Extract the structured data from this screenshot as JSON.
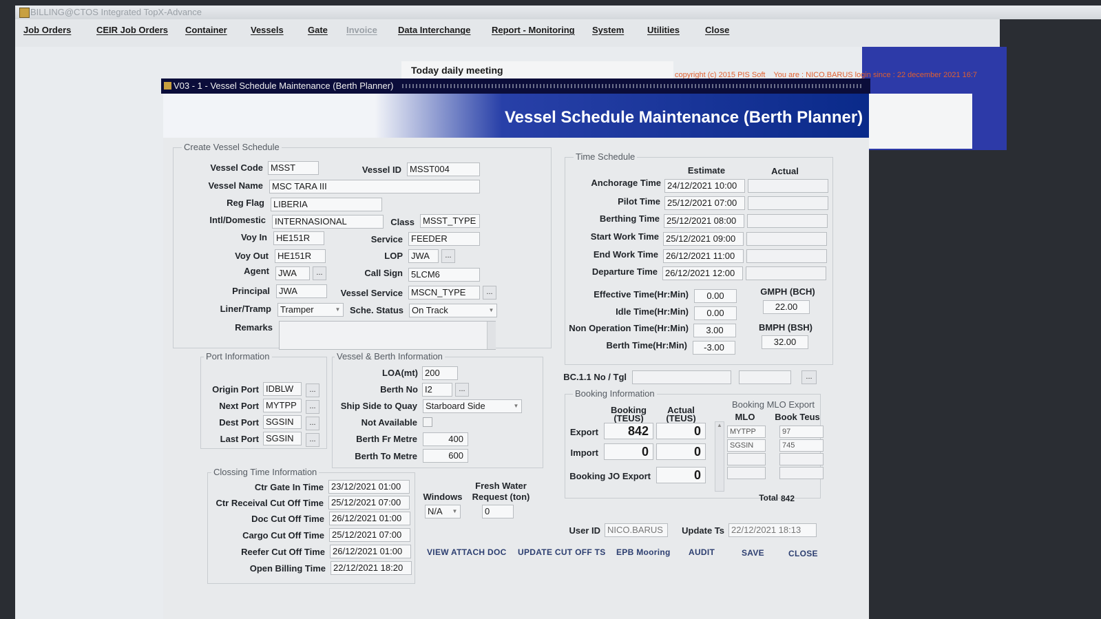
{
  "app": {
    "title": "BILLING@CTOS Integrated TopX-Advance"
  },
  "menu": [
    "Job Orders",
    "CEIR Job Orders",
    "Container",
    "Vessels",
    "Gate",
    "Invoice",
    "Data Interchange",
    "Report - Monitoring",
    "System",
    "Utilities",
    "Close"
  ],
  "banner": {
    "meeting": "Today daily meeting",
    "copyright": "copyright (c) 2015 PIS Soft",
    "user_info": "You are : NICO.BARUS login since : 22 december 2021 16:7"
  },
  "dialog": {
    "window_title": "V03 - 1 - Vessel Schedule Maintenance (Berth Planner)",
    "heading": "Vessel Schedule Maintenance (Berth Planner)"
  },
  "create": {
    "group_title": "Create Vessel Schedule",
    "labels": {
      "vessel_code": "Vessel Code",
      "vessel_id": "Vessel ID",
      "vessel_name": "Vessel Name",
      "reg_flag": "Reg Flag",
      "intl_domestic": "Intl/Domestic",
      "class": "Class",
      "voy_in": "Voy In",
      "service": "Service",
      "voy_out": "Voy Out",
      "lop": "LOP",
      "agent": "Agent",
      "call_sign": "Call Sign",
      "principal": "Principal",
      "vessel_service": "Vessel Service",
      "liner_tramp": "Liner/Tramp",
      "sche_status": "Sche. Status",
      "remarks": "Remarks"
    },
    "values": {
      "vessel_code": "MSST",
      "vessel_id": "MSST004",
      "vessel_name": "MSC TARA III",
      "reg_flag": "LIBERIA",
      "intl_domestic": "INTERNASIONAL",
      "class": "MSST_TYPE",
      "voy_in": "HE151R",
      "service": "FEEDER",
      "voy_out": "HE151R",
      "lop": "JWA",
      "agent": "JWA",
      "call_sign": "5LCM6",
      "principal": "JWA",
      "vessel_service": "MSCN_TYPE",
      "liner_tramp": "Tramper",
      "sche_status": "On Track",
      "remarks": ""
    }
  },
  "time_schedule": {
    "group_title": "Time Schedule",
    "col_estimate": "Estimate",
    "col_actual": "Actual",
    "rows": [
      {
        "label": "Anchorage Time",
        "estimate": "24/12/2021 10:00",
        "actual": ""
      },
      {
        "label": "Pilot Time",
        "estimate": "25/12/2021 07:00",
        "actual": ""
      },
      {
        "label": "Berthing Time",
        "estimate": "25/12/2021 08:00",
        "actual": ""
      },
      {
        "label": "Start Work Time",
        "estimate": "25/12/2021 09:00",
        "actual": ""
      },
      {
        "label": "End Work Time",
        "estimate": "26/12/2021 11:00",
        "actual": ""
      },
      {
        "label": "Departure Time",
        "estimate": "26/12/2021 12:00",
        "actual": ""
      }
    ],
    "effective_label": "Effective Time(Hr:Min)",
    "effective": "0.00",
    "idle_label": "Idle Time(Hr:Min)",
    "idle": "0.00",
    "nonop_label": "Non Operation Time(Hr:Min)",
    "nonop": "3.00",
    "berth_label": "Berth Time(Hr:Min)",
    "berth": "-3.00",
    "gmph_label": "GMPH (BCH)",
    "gmph": "22.00",
    "bmph_label": "BMPH (BSH)",
    "bmph": "32.00"
  },
  "port": {
    "group_title": "Port Information",
    "labels": {
      "origin": "Origin Port",
      "next": "Next Port",
      "dest": "Dest Port",
      "last": "Last Port"
    },
    "values": {
      "origin": "IDBLW",
      "next": "MYTPP",
      "dest": "SGSIN",
      "last": "SGSIN"
    }
  },
  "berth_info": {
    "group_title": "Vessel & Berth Information",
    "labels": {
      "loa": "LOA(mt)",
      "berth_no": "Berth No",
      "ship_side": "Ship Side to Quay",
      "not_available": "Not Available",
      "berth_fr": "Berth Fr Metre",
      "berth_to": "Berth To Metre"
    },
    "values": {
      "loa": "200",
      "berth_no": "I2",
      "ship_side": "Starboard Side",
      "berth_fr": "400",
      "berth_to": "600"
    }
  },
  "bc": {
    "label": "BC.1.1 No / Tgl",
    "no": "",
    "tgl": ""
  },
  "booking": {
    "group_title": "Booking Information",
    "col_booking_1": "Booking",
    "col_booking_2": "(TEUS)",
    "col_actual_1": "Actual",
    "col_actual_2": "(TEUS)",
    "export_label": "Export",
    "export_booking": "842",
    "export_actual": "0",
    "import_label": "Import",
    "import_booking": "0",
    "import_actual": "0",
    "jo_label": "Booking JO Export",
    "jo_value": "0"
  },
  "mlo": {
    "group_title": "Booking MLO Export",
    "col_mlo": "MLO",
    "col_teus": "Book Teus",
    "rows": [
      {
        "mlo": "MYTPP",
        "teus": "97"
      },
      {
        "mlo": "SGSIN",
        "teus": "745"
      }
    ],
    "total_label": "Total",
    "total": "842"
  },
  "closing": {
    "group_title": "Clossing Time Information",
    "rows": [
      {
        "label": "Ctr Gate In Time",
        "value": "23/12/2021 01:00"
      },
      {
        "label": "Ctr Receival Cut Off Time",
        "value": "25/12/2021 07:00"
      },
      {
        "label": "Doc Cut Off Time",
        "value": "26/12/2021 01:00"
      },
      {
        "label": "Cargo Cut Off Time",
        "value": "25/12/2021 07:00"
      },
      {
        "label": "Reefer Cut Off Time",
        "value": "26/12/2021 01:00"
      },
      {
        "label": "Open Billing Time",
        "value": "22/12/2021 18:20"
      }
    ],
    "windows_label": "Windows",
    "windows": "N/A",
    "fresh_water_label_1": "Fresh Water",
    "fresh_water_label_2": "Request (ton)",
    "fresh_water": "0"
  },
  "audit": {
    "user_id_label": "User ID",
    "user_id": "NICO.BARUS",
    "update_label": "Update Ts",
    "update_ts": "22/12/2021 18:13"
  },
  "buttons": {
    "view_attach": "VIEW ATTACH DOC",
    "update_cutoff": "UPDATE CUT OFF TS",
    "epb": "EPB Mooring",
    "audit": "AUDIT",
    "save": "SAVE",
    "close": "CLOSE"
  }
}
